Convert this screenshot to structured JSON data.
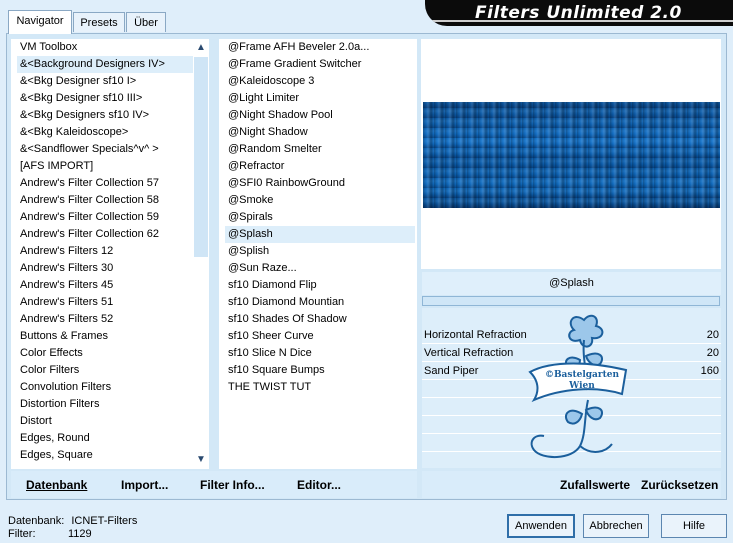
{
  "tabs": [
    "Navigator",
    "Presets",
    "Über"
  ],
  "app_title": "Filters Unlimited 2.0",
  "categories": [
    "VM Toolbox",
    "&<Background Designers IV>",
    "&<Bkg Designer sf10 I>",
    "&<Bkg Designer sf10 III>",
    "&<Bkg Designers sf10 IV>",
    "&<Bkg Kaleidoscope>",
    "&<Sandflower Specials^v^ >",
    "[AFS IMPORT]",
    "Andrew's Filter Collection 57",
    "Andrew's Filter Collection 58",
    "Andrew's Filter Collection 59",
    "Andrew's Filter Collection 62",
    "Andrew's Filters 12",
    "Andrew's Filters 30",
    "Andrew's Filters 45",
    "Andrew's Filters 51",
    "Andrew's Filters 52",
    "Buttons & Frames",
    "Color Effects",
    "Color Filters",
    "Convolution Filters",
    "Distortion Filters",
    "Distort",
    "Edges, Round",
    "Edges, Square"
  ],
  "selected_category_index": 1,
  "filters": [
    "@Frame AFH Beveler 2.0a...",
    "@Frame Gradient Switcher",
    "@Kaleidoscope 3",
    "@Light Limiter",
    "@Night Shadow Pool",
    "@Night Shadow",
    "@Random Smelter",
    "@Refractor",
    "@SFI0 RainbowGround",
    "@Smoke",
    "@Spirals",
    "@Splash",
    "@Splish",
    "@Sun Raze...",
    "sf10 Diamond Flip",
    "sf10 Diamond Mountian",
    "sf10 Shades Of Shadow",
    "sf10 Sheer Curve",
    "sf10 Slice N Dice",
    "sf10 Square Bumps",
    "THE TWIST TUT"
  ],
  "selected_filter_index": 11,
  "left_buttons": {
    "datenbank": "Datenbank",
    "import": "Import...",
    "filter_info": "Filter Info...",
    "editor": "Editor..."
  },
  "right_buttons": {
    "random": "Zufallswerte",
    "reset": "Zurücksetzen"
  },
  "current_filter": "@Splash",
  "params": [
    {
      "name": "Horizontal Refraction",
      "value": "20"
    },
    {
      "name": "Vertical Refraction",
      "value": "20"
    },
    {
      "name": "Sand Piper",
      "value": "160"
    }
  ],
  "watermark": {
    "line1": "©Bastelgarten",
    "line2": "Wien"
  },
  "status": {
    "db_label": "Datenbank:",
    "db_value": "ICNET-Filters",
    "filter_label": "Filter:",
    "filter_value": "1129"
  },
  "dialog_buttons": {
    "apply": "Anwenden",
    "cancel": "Abbrechen",
    "help": "Hilfe"
  }
}
